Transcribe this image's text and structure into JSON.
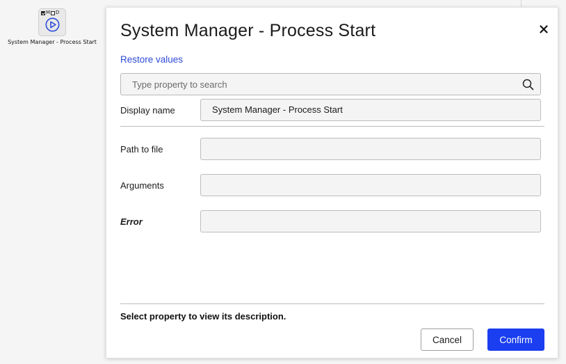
{
  "node": {
    "flag_m": "M",
    "flag_d": "D",
    "label": "System Manager - Process Start"
  },
  "dialog": {
    "title": "System Manager - Process Start",
    "restore_label": "Restore values",
    "search_placeholder": "Type property to search",
    "properties": {
      "display_name": {
        "label": "Display name",
        "value": "System Manager - Process Start"
      },
      "path_to_file": {
        "label": "Path to file",
        "value": ""
      },
      "arguments": {
        "label": "Arguments",
        "value": ""
      },
      "error": {
        "label": "Error",
        "value": ""
      }
    },
    "description": "Select property to view its description.",
    "cancel_label": "Cancel",
    "confirm_label": "Confirm"
  },
  "colors": {
    "accent": "#1a3ef0",
    "link": "#2c4bd6",
    "field_bg": "#f4f4f4"
  },
  "icons": {
    "close": "close-icon",
    "search": "search-icon",
    "play": "play-circle-icon"
  }
}
